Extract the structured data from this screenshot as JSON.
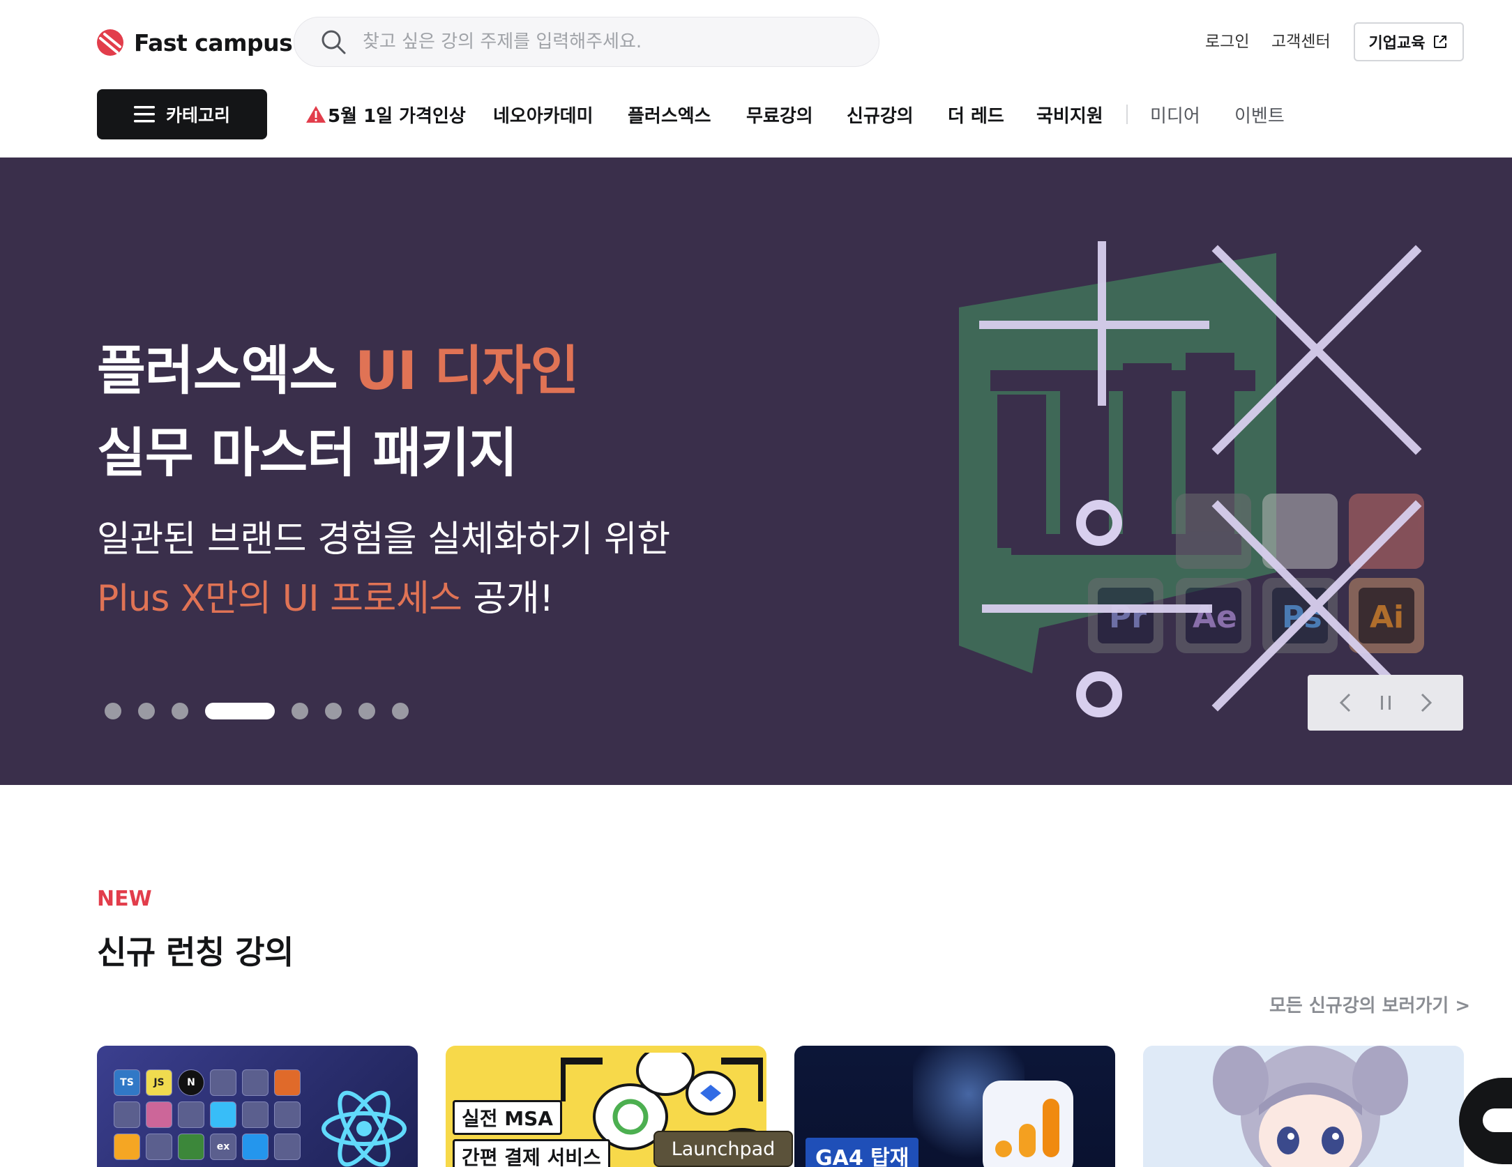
{
  "header": {
    "logo_text": "Fast campus",
    "search_placeholder": "찾고 싶은 강의 주제를 입력해주세요.",
    "login": "로그인",
    "customer_center": "고객센터",
    "corp_edu": "기업교육",
    "category_button": "카테고리",
    "nav_bold": [
      "5월 1일 가격인상",
      "네오아카데미",
      "플러스엑스",
      "무료강의",
      "신규강의",
      "더 레드",
      "국비지원"
    ],
    "nav_light": [
      "미디어",
      "이벤트"
    ]
  },
  "hero": {
    "title_line1_white": "플러스엑스 ",
    "title_line1_accent": "UI 디자인",
    "title_line2": "실무 마스터 패키지",
    "sub_line1": "일관된 브랜드 경험을 실체화하기 위한",
    "sub_line2_accent": "Plus X만의 UI 프로세스",
    "sub_line2_white": " 공개!",
    "slide_count": 8,
    "active_slide": 4,
    "colors": {
      "background": "#3a2f4b",
      "accent": "#e07355"
    }
  },
  "section": {
    "tag": "NEW",
    "title": "신규 런칭 강의",
    "see_all": "모든 신규강의 보러가기 >"
  },
  "cards": {
    "card1_tiles": [
      "TS",
      "JS",
      "N",
      "ex"
    ],
    "card2_labels": [
      "실전 MSA",
      "간편 결제 서비스"
    ],
    "card3_label": "GA4 탑재",
    "launchpad": "Launchpad"
  },
  "icons": [
    "search-icon",
    "external-link-icon",
    "menu-icon",
    "warning-icon",
    "chevron-left-icon",
    "pause-icon",
    "chevron-right-icon",
    "chat-icon"
  ]
}
